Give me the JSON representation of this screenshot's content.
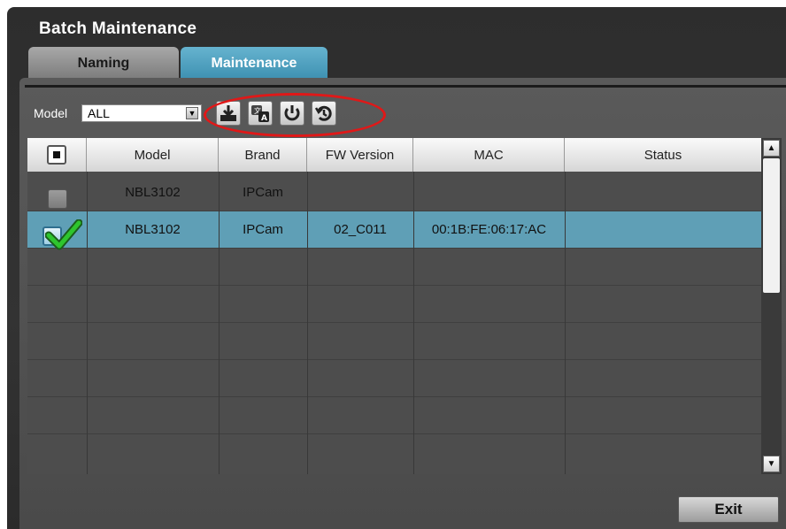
{
  "window": {
    "title": "Batch Maintenance"
  },
  "tabs": [
    {
      "label": "Naming",
      "active": false
    },
    {
      "label": "Maintenance",
      "active": true
    }
  ],
  "filter": {
    "label": "Model",
    "selected": "ALL"
  },
  "toolbar": {
    "icons": [
      "download-icon",
      "language-icon",
      "power-icon",
      "restore-icon"
    ],
    "highlight_color": "#e01818"
  },
  "table": {
    "columns": [
      "Model",
      "Brand",
      "FW Version",
      "MAC",
      "Status"
    ],
    "rows": [
      {
        "checked": false,
        "model": "NBL3102",
        "brand": "IPCam",
        "fw": "",
        "mac": "",
        "status": ""
      },
      {
        "checked": true,
        "model": "NBL3102",
        "brand": "IPCam",
        "fw": "02_C011",
        "mac": "00:1B:FE:06:17:AC",
        "status": ""
      }
    ]
  },
  "colors": {
    "accent": "#4a9dbd",
    "selected_row": "#5f9fb6"
  },
  "buttons": {
    "exit": "Exit"
  }
}
